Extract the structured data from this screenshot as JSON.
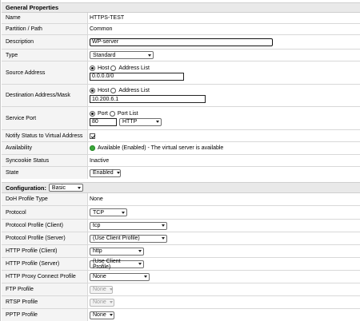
{
  "general": {
    "title": "General Properties",
    "name_label": "Name",
    "name_value": "HTTPS-TEST",
    "partition_label": "Partition / Path",
    "partition_value": "Common",
    "description_label": "Description",
    "description_value": "WP-server",
    "type_label": "Type",
    "type_value": "Standard",
    "source_label": "Source Address",
    "source_host": "Host",
    "source_list": "Address List",
    "source_value": "0.0.0.0/0",
    "dest_label": "Destination Address/Mask",
    "dest_host": "Host",
    "dest_list": "Address List",
    "dest_value": "10.200.6.1",
    "port_label": "Service Port",
    "port_option": "Port",
    "port_list_option": "Port List",
    "port_value": "80",
    "port_protocol": "HTTP",
    "notify_label": "Notify Status to Virtual Address",
    "availability_label": "Availability",
    "availability_value": "Available (Enabled) - The virtual server is available",
    "syncookie_label": "Syncookie Status",
    "syncookie_value": "Inactive",
    "state_label": "State",
    "state_value": "Enabled"
  },
  "config": {
    "title": "Configuration:",
    "mode": "Basic",
    "doh_label": "DoH Profile Type",
    "doh_value": "None",
    "protocol_label": "Protocol",
    "protocol_value": "TCP",
    "pp_client_label": "Protocol Profile (Client)",
    "pp_client_value": "tcp",
    "pp_server_label": "Protocol Profile (Server)",
    "pp_server_value": "(Use Client Profile)",
    "http_client_label": "HTTP Profile (Client)",
    "http_client_value": "http",
    "http_server_label": "HTTP Profile (Server)",
    "http_server_value": "(Use Client Profile)",
    "http_proxy_label": "HTTP Proxy Connect Profile",
    "http_proxy_value": "None",
    "ftp_label": "FTP Profile",
    "ftp_value": "None",
    "rtsp_label": "RTSP Profile",
    "rtsp_value": "None",
    "pptp_label": "PPTP Profile",
    "pptp_value": "None"
  }
}
